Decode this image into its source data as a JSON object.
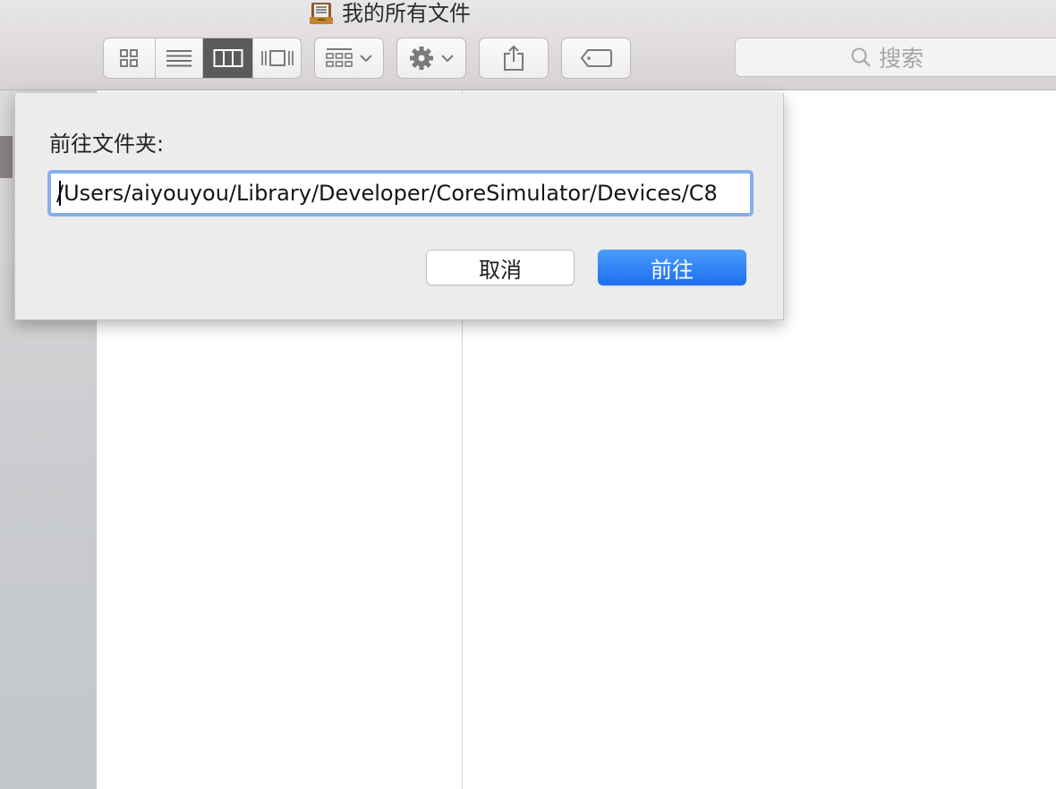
{
  "window": {
    "title": "我的所有文件",
    "title_icon": "drawer-icon"
  },
  "toolbar": {
    "view_modes": [
      {
        "icon": "icon-view-icon",
        "active": false
      },
      {
        "icon": "list-view-icon",
        "active": false
      },
      {
        "icon": "column-view-icon",
        "active": true
      },
      {
        "icon": "cover-flow-icon",
        "active": false
      }
    ],
    "group_button_icon": "arrange-icon",
    "action_button_icon": "gear-icon",
    "share_button_icon": "share-icon",
    "tag_button_icon": "tag-icon",
    "search_placeholder": "搜索"
  },
  "dialog": {
    "label": "前往文件夹:",
    "path_value": "/Users/aiyouyou/Library/Developer/CoreSimulator/Devices/C8",
    "cancel_label": "取消",
    "go_label": "前往",
    "accent_color": "#1c6ff1"
  }
}
